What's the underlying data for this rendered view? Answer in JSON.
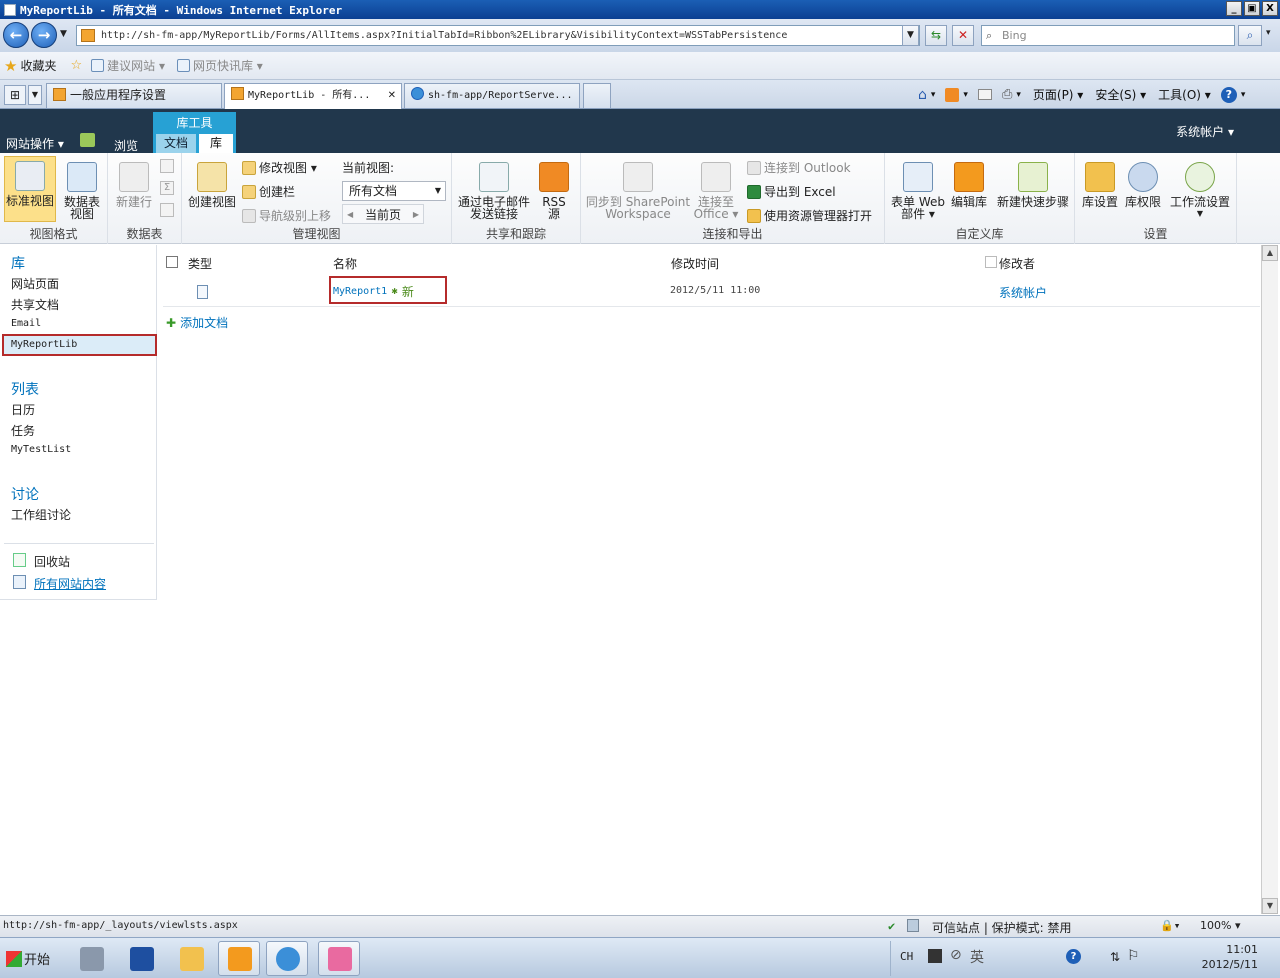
{
  "window": {
    "title": "MyReportLib - 所有文档 - Windows Internet Explorer",
    "btn_min": "_",
    "btn_max": "▣",
    "btn_close": "X"
  },
  "address": {
    "url": "http://sh-fm-app/MyReportLib/Forms/AllItems.aspx?InitialTabId=Ribbon%2ELibrary&VisibilityContext=WSSTabPersistence",
    "search_placeholder": "Bing"
  },
  "favorites": {
    "label": "收藏夹",
    "items": [
      "建议网站 ▾",
      "网页快讯库 ▾"
    ]
  },
  "browser_tabs": [
    {
      "label": "一般应用程序设置"
    },
    {
      "label": "MyReportLib - 所有..."
    },
    {
      "label": "sh-fm-app/ReportServe..."
    }
  ],
  "command_bar": {
    "page": "页面(P) ▾",
    "safety": "安全(S) ▾",
    "tools": "工具(O) ▾"
  },
  "sp_header": {
    "site_actions": "网站操作 ▾",
    "browse": "浏览",
    "context_group": "库工具",
    "tab_documents": "文档",
    "tab_library": "库",
    "account": "系统帐户 ▾"
  },
  "ribbon": {
    "view_format": {
      "label": "视图格式",
      "standard_view": "标准视图",
      "datasheet_view_1": "数据表",
      "datasheet_view_2": "视图"
    },
    "datasheet": {
      "label": "数据表",
      "new_row": "新建行"
    },
    "manage_views": {
      "label": "管理视图",
      "create_view": "创建视图",
      "modify_view": "修改视图 ▾",
      "create_column": "创建栏",
      "navigate_up": "导航级别上移",
      "current_view_label": "当前视图:",
      "current_view_value": "所有文档",
      "current_page": "当前页"
    },
    "share_track": {
      "label": "共享和跟踪",
      "email_link_1": "通过电子邮件",
      "email_link_2": "发送链接",
      "rss_1": "RSS",
      "rss_2": "源"
    },
    "connect_export": {
      "label": "连接和导出",
      "sync_1": "同步到 SharePoint",
      "sync_2": "Workspace",
      "connect_office_1": "连接至",
      "connect_office_2": "Office ▾",
      "connect_outlook": "连接到 Outlook",
      "export_excel": "导出到 Excel",
      "open_explorer": "使用资源管理器打开"
    },
    "customize": {
      "label": "自定义库",
      "form_web_1": "表单 Web",
      "form_web_2": "部件 ▾",
      "edit_library": "编辑库",
      "new_quick_step": "新建快速步骤"
    },
    "settings": {
      "label": "设置",
      "library_settings": "库设置",
      "library_permissions": "库权限",
      "workflow_settings": "工作流设置"
    }
  },
  "left_nav": {
    "libraries_heading": "库",
    "libraries": [
      "网站页面",
      "共享文档",
      "Email",
      "MyReportLib"
    ],
    "lists_heading": "列表",
    "lists": [
      "日历",
      "任务",
      "MyTestList"
    ],
    "discussions_heading": "讨论",
    "discussions": [
      "工作组讨论"
    ],
    "recycle_bin": "回收站",
    "all_site_content": "所有网站内容"
  },
  "list": {
    "columns": [
      "类型",
      "名称",
      "修改时间",
      "修改者"
    ],
    "rows": [
      {
        "name": "MyReport1",
        "new_tag": "新",
        "modified": "2012/5/11 11:00",
        "modified_by": "系统帐户"
      }
    ],
    "add_document": "添加文档"
  },
  "status_bar": {
    "url": "http://sh-fm-app/_layouts/viewlsts.aspx",
    "zone": "可信站点 | 保护模式: 禁用",
    "zoom": "100% ▾"
  },
  "taskbar": {
    "start": "开始",
    "lang": "CH",
    "ime": "英",
    "time": "11:01",
    "date": "2012/5/11"
  },
  "colors": {
    "sp_header_bg": "#21374c",
    "ribbon_context": "#27a1d4",
    "link_blue": "#0072bc",
    "highlight_red": "#b52b2b"
  }
}
